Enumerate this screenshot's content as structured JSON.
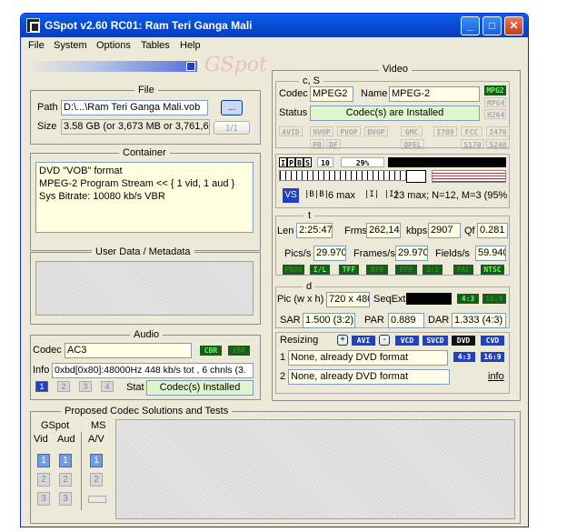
{
  "window": {
    "title": "GSpot v2.60 RC01: Ram Teri Ganga Mali",
    "minimize": "_",
    "maximize": "□",
    "close": "✕"
  },
  "menu": [
    "File",
    "System",
    "Options",
    "Tables",
    "Help"
  ],
  "logo": "GSpot",
  "file": {
    "title": "File",
    "path_label": "Path",
    "path_value": "D:\\...\\Ram Teri Ganga Mali.vob",
    "browse": "...",
    "size_label": "Size",
    "size_value": "3.58 GB (or 3,673 MB or 3,761,63",
    "counter": "1/1"
  },
  "container": {
    "title": "Container",
    "lines": [
      "DVD \"VOB\" format",
      "MPEG-2 Program Stream << { 1 vid, 1 aud }",
      "Sys Bitrate: 10080 kb/s VBR"
    ]
  },
  "userdata": {
    "title": "User Data / Metadata"
  },
  "audio": {
    "title": "Audio",
    "codec_label": "Codec",
    "codec_value": "AC3",
    "cbr": "CBR",
    "vbr": "VBR",
    "info_label": "Info",
    "info_value": "0xbd[0x80]:48000Hz  448 kb/s tot , 6 chnls (3.",
    "stat_label": "Stat",
    "stat_value": "Codec(s) Installed",
    "nums": [
      "1",
      "2",
      "3",
      "4"
    ]
  },
  "video": {
    "title": "Video",
    "cs_label": "c, S",
    "codec_label": "Codec",
    "codec_value": "MPEG2",
    "name_label": "Name",
    "name_value": "MPEG-2",
    "status_label": "Status",
    "status_value": "Codec(s) are Installed",
    "codec_tags": [
      "MPG2",
      "MPG4",
      "H264"
    ],
    "flags_row1": [
      "AVID",
      "NVOP",
      "PVOP",
      "BVOP",
      "GMC",
      "I709",
      "FCC",
      "I470"
    ],
    "flags_row2": [
      "PB",
      "DF",
      "QPEL",
      "S170",
      "S240"
    ],
    "ipbs": [
      "I",
      "P",
      "B",
      "S"
    ],
    "gop_ten": "10",
    "gop_pct": "29%",
    "b_max": "6 max",
    "i_max": "23 max; N=12, M=3 (95%",
    "t_label": "t",
    "len_label": "Len",
    "len_value": "2:25:47",
    "frms_label": "Frms",
    "frms_value": "262,143",
    "kbps_label": "kbps",
    "kbps_value": "2907",
    "qf_label": "Qf",
    "qf_value": "0.281",
    "pics_label": "Pics/s",
    "pics_value": "29.970",
    "frames_label": "Frames/s",
    "frames_value": "29.970",
    "fields_label": "Fields/s",
    "fields_value": "59.940",
    "mode_tags": [
      "PROG",
      "I/L",
      "TFF",
      "BFR",
      "FFP",
      "3:2",
      "PAL",
      "NTSC"
    ],
    "d_label": "d",
    "pic_label": "Pic (w x h)",
    "pic_value": "720 x 480",
    "seqext_label": "SeqExt",
    "ar43": "4:3",
    "ar169": "16:9",
    "sar_label": "SAR",
    "sar_value": "1.500 (3:2)",
    "par_label": "PAR",
    "par_value": "0.889",
    "dar_label": "DAR",
    "dar_value": "1.333 (4:3)",
    "resizing_label": "Resizing",
    "plus": "+",
    "avi": "AVI",
    "minus": "-",
    "vcd": "VCD",
    "svcd": "SVCD",
    "dvd": "DVD",
    "cvd": "CVD",
    "r1_num": "1",
    "r1_value": "None, already DVD format",
    "r2_num": "2",
    "r2_value": "None, already DVD format",
    "info_link": "info"
  },
  "proposed": {
    "title": "Proposed Codec Solutions and Tests",
    "gspot": "GSpot",
    "ms": "MS",
    "vid": "Vid",
    "aud": "Aud",
    "av": "A/V",
    "n1": "1",
    "n2": "2",
    "n3": "3"
  }
}
